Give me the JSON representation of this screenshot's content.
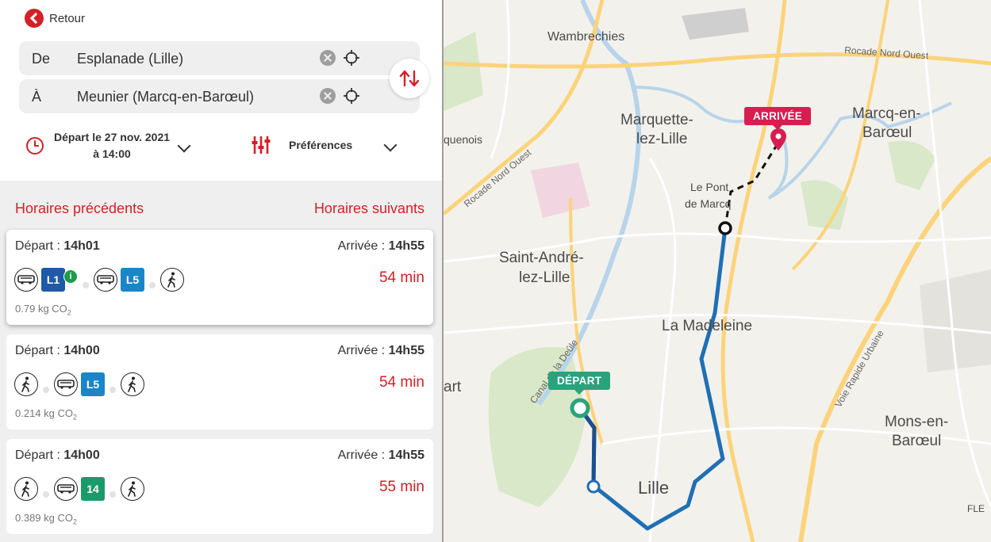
{
  "header": {
    "back_label": "Retour"
  },
  "from": {
    "label": "De",
    "value": "Esplanade (Lille)"
  },
  "to": {
    "label": "À",
    "value": "Meunier (Marcq-en-Barœul)"
  },
  "options": {
    "departure_line1": "Départ le 27 nov. 2021",
    "departure_line2": "à 14:00",
    "preferences": "Préférences"
  },
  "nav": {
    "previous": "Horaires précédents",
    "next": "Horaires suivants"
  },
  "departure_prefix": "Départ : ",
  "arrival_prefix": "Arrivée : ",
  "co2_unit": "kg CO",
  "co2_sub": "2",
  "results": [
    {
      "departure": "14h01",
      "arrival": "14h55",
      "duration": "54 min",
      "co2": "0.79",
      "line_a": "L1",
      "line_b": "L5",
      "info": "i"
    },
    {
      "departure": "14h00",
      "arrival": "14h55",
      "duration": "54 min",
      "co2": "0.214",
      "line": "L5"
    },
    {
      "departure": "14h00",
      "arrival": "14h55",
      "duration": "55 min",
      "co2": "0.389",
      "line": "14"
    }
  ],
  "colors": {
    "accent": "#d32027",
    "line_L1": "#1e5aa5",
    "line_L5": "#1a86c8",
    "line_14": "#1a9b6b",
    "route": "#1f6fb5",
    "depart_pin": "#2aa37d",
    "arrival_pin": "#d81d51"
  },
  "map": {
    "depart_label": "DÉPART",
    "arrival_label": "ARRIVÉE",
    "places": {
      "wambrechies": "Wambrechies",
      "rocade_nord_ouest_top": "Rocade Nord Ouest",
      "marquette_1": "Marquette-",
      "marquette_2": "lez-Lille",
      "marcq_1": "Marcq-en-",
      "marcq_2": "Barœul",
      "quenois": "quenois",
      "rocade_nord_ouest_left": "Rocade Nord Ouest",
      "le_pont_1": "Le Pont",
      "le_pont_2": "de Marcq",
      "saint_andre_1": "Saint-André-",
      "saint_andre_2": "lez-Lille",
      "la_madeleine": "La Madeleine",
      "canal_1": "Canal de la Deûle",
      "voie_rapide": "Voie Rapide Urbaine",
      "art": "art",
      "mons_1": "Mons-en-",
      "mons_2": "Barœul",
      "lille": "Lille",
      "fle": "FLE"
    }
  }
}
